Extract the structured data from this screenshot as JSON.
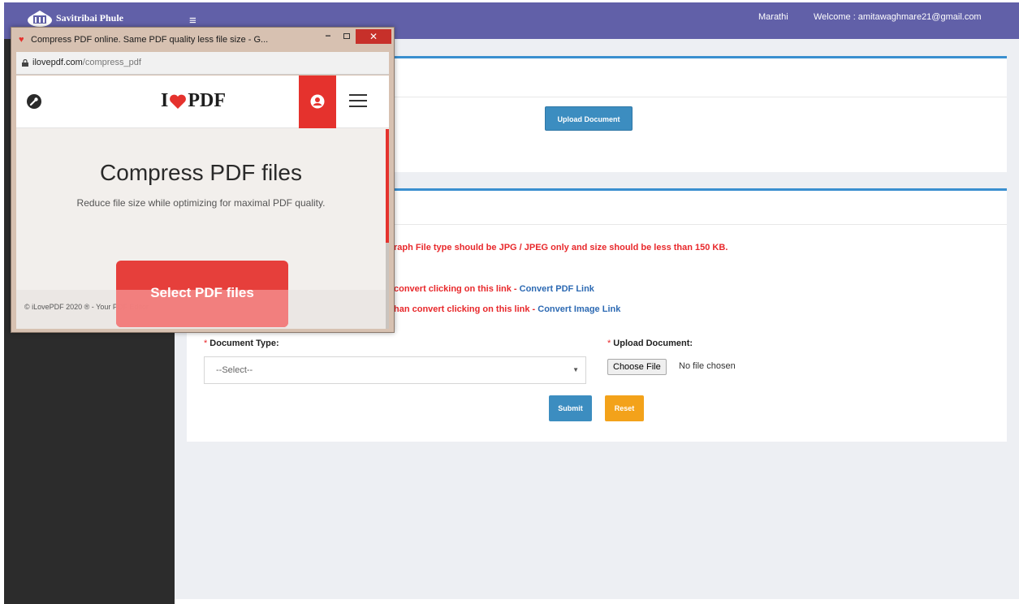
{
  "topbar": {
    "logo_text": "Savitribai Phule",
    "language": "Marathi",
    "welcome": "Welcome : amitawaghmare21@gmail.com"
  },
  "upload_panel": {
    "upload_button": "Upload Document"
  },
  "form_panel": {
    "warning": "raph File type should be JPG / JPEG only and size should be less than 150 KB.",
    "pdf_line_text": "convert clicking on this link - ",
    "pdf_link": "Convert PDF Link",
    "image_line_text": "han convert clicking on this link - ",
    "image_link": "Convert Image Link",
    "doc_type_label": "Document Type:",
    "doc_type_value": "--Select--",
    "upload_label": "Upload Document:",
    "choose_file": "Choose File",
    "no_file": "No file chosen",
    "submit": "Submit",
    "reset": "Reset",
    "required_marker": "*"
  },
  "browser": {
    "title": "Compress PDF online. Same PDF quality less file size - G...",
    "url_host": "ilovepdf.com",
    "url_path": "/compress_pdf",
    "min_glyph": "−",
    "close_glyph": "✕"
  },
  "ilovepdf": {
    "logo_left": "I",
    "logo_right": "PDF",
    "heading": "Compress PDF files",
    "subtitle": "Reduce file size while optimizing for maximal PDF quality.",
    "select_button": "Select PDF files",
    "footer": "© iLovePDF 2020 ® - Your PDF Editor"
  },
  "colors": {
    "topbar": "#6160a8",
    "sidebar": "#2c2c2c",
    "accent_red": "#e5322d",
    "link_blue": "#2d6ab3",
    "button_blue": "#3c8dc0",
    "button_orange": "#f3a21a"
  }
}
